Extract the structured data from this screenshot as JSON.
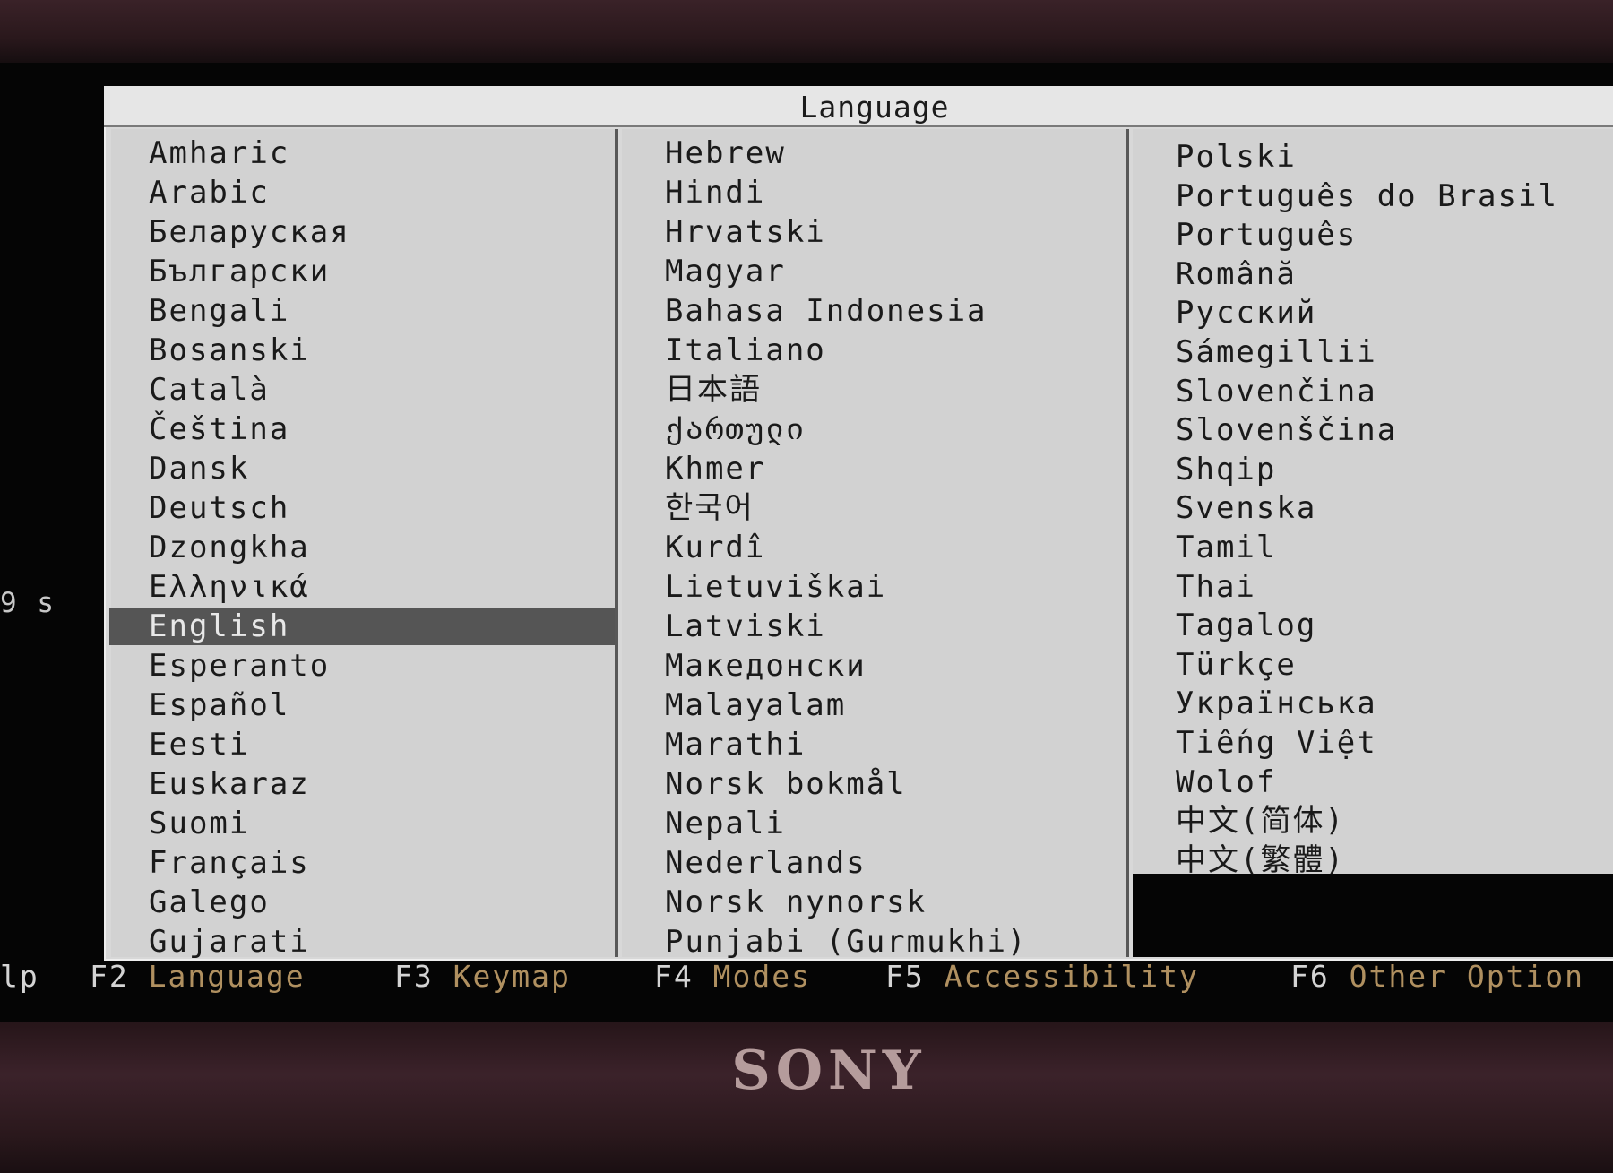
{
  "dialog": {
    "title": "Language"
  },
  "countdown": "9 s",
  "columns": [
    [
      "Amharic",
      "Arabic",
      "Беларуская",
      "Български",
      "Bengali",
      "Bosanski",
      "Català",
      "Čeština",
      "Dansk",
      "Deutsch",
      "Dzongkha",
      "Ελληνικά",
      "English",
      "Esperanto",
      "Español",
      "Eesti",
      "Euskaraz",
      "Suomi",
      "Français",
      "Galego",
      "Gujarati"
    ],
    [
      "Hebrew",
      "Hindi",
      "Hrvatski",
      "Magyar",
      "Bahasa Indonesia",
      "Italiano",
      "日本語",
      "ქართული",
      "Khmer",
      "한국어",
      "Kurdî",
      "Lietuviškai",
      "Latviski",
      "Македонски",
      "Malayalam",
      "Marathi",
      "Norsk bokmål",
      "Nepali",
      "Nederlands",
      "Norsk nynorsk",
      "Punjabi (Gurmukhi)"
    ],
    [
      "Polski",
      "Português do Brasil",
      "Português",
      "Română",
      "Русский",
      "Sámegillii",
      "Slovenčina",
      "Slovenščina",
      "Shqip",
      "Svenska",
      "Tamil",
      "Thai",
      "Tagalog",
      "Türkçe",
      "Українська",
      "Tiếng Việt",
      "Wolof",
      "中文(简体)",
      "中文(繁體)"
    ]
  ],
  "selected": "English",
  "function_keys": [
    {
      "key": "",
      "label": "lp"
    },
    {
      "key": "F2",
      "label": "Language"
    },
    {
      "key": "F3",
      "label": "Keymap"
    },
    {
      "key": "F4",
      "label": "Modes"
    },
    {
      "key": "F5",
      "label": "Accessibility"
    },
    {
      "key": "F6",
      "label": "Other Option"
    }
  ],
  "brand": "SONY"
}
